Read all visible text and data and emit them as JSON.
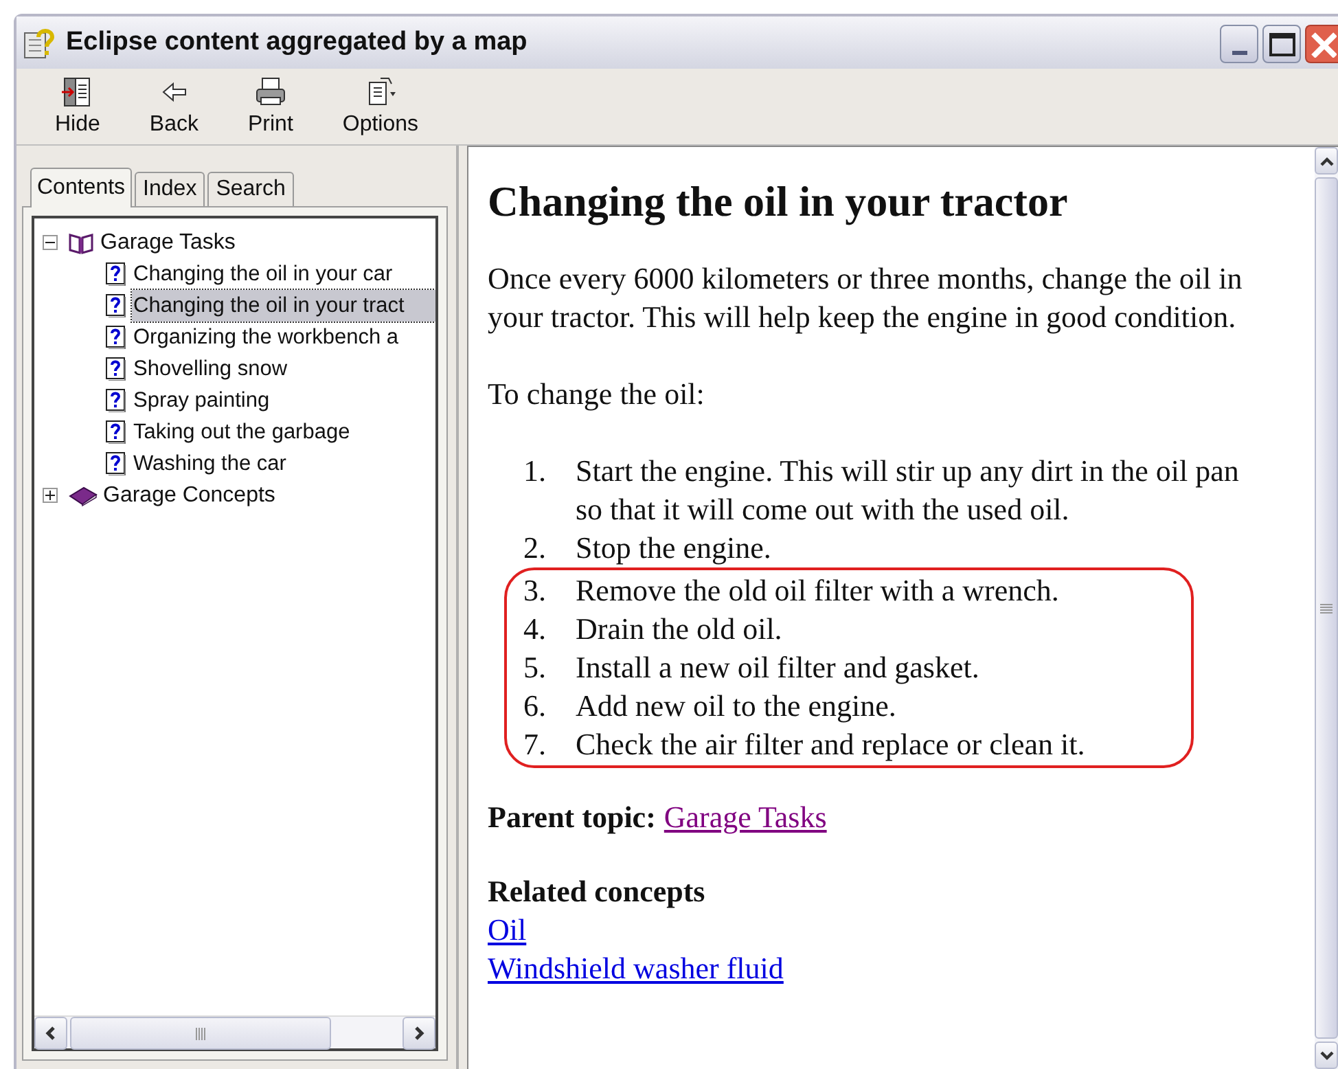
{
  "window": {
    "title": "Eclipse content aggregated by a map"
  },
  "toolbar": [
    {
      "kind": "hide",
      "label": "Hide"
    },
    {
      "kind": "back",
      "label": "Back"
    },
    {
      "kind": "print",
      "label": "Print"
    },
    {
      "kind": "options",
      "label": "Options"
    }
  ],
  "tabs": [
    {
      "label": "Contents",
      "selected": true
    },
    {
      "label": "Index",
      "selected": false
    },
    {
      "label": "Search",
      "selected": false
    }
  ],
  "tree": [
    {
      "kind": "book",
      "label": "Garage Tasks",
      "expanded": true,
      "children": [
        {
          "kind": "topic",
          "label": "Changing the oil in your car",
          "selected": false
        },
        {
          "kind": "topic",
          "label": "Changing the oil in your tract",
          "selected": true
        },
        {
          "kind": "topic",
          "label": "Organizing the workbench a",
          "selected": false
        },
        {
          "kind": "topic",
          "label": "Shovelling snow",
          "selected": false
        },
        {
          "kind": "topic",
          "label": "Spray painting",
          "selected": false
        },
        {
          "kind": "topic",
          "label": "Taking out the garbage",
          "selected": false
        },
        {
          "kind": "topic",
          "label": "Washing the car",
          "selected": false
        }
      ]
    },
    {
      "kind": "book",
      "label": "Garage Concepts",
      "expanded": false
    }
  ],
  "content": {
    "heading": "Changing the oil in your tractor",
    "paragraphs": [
      "Once every 6000 kilometers or three months, change the oil in your tractor. This will help keep the engine in good condition.",
      "To change the oil:"
    ],
    "steps": [
      {
        "number": "1.",
        "text": "Start the engine. This will stir up any dirt in the oil pan so that it will come out with the used oil.",
        "circled": false
      },
      {
        "number": "2.",
        "text": "Stop the engine.",
        "circled": false
      },
      {
        "number": "3.",
        "text": "Remove the old oil filter with a wrench.",
        "circled": true
      },
      {
        "number": "4.",
        "text": "Drain the old oil.",
        "circled": true
      },
      {
        "number": "5.",
        "text": "Install a new oil filter and gasket.",
        "circled": true
      },
      {
        "number": "6.",
        "text": "Add new oil to the engine.",
        "circled": true
      },
      {
        "number": "7.",
        "text": "Check the air filter and replace or clean it.",
        "circled": true
      }
    ],
    "parent_topic": {
      "label": "Parent topic:",
      "link": "Garage Tasks"
    },
    "related": {
      "heading": "Related concepts",
      "links": [
        "Oil",
        "Windshield washer fluid"
      ]
    }
  }
}
